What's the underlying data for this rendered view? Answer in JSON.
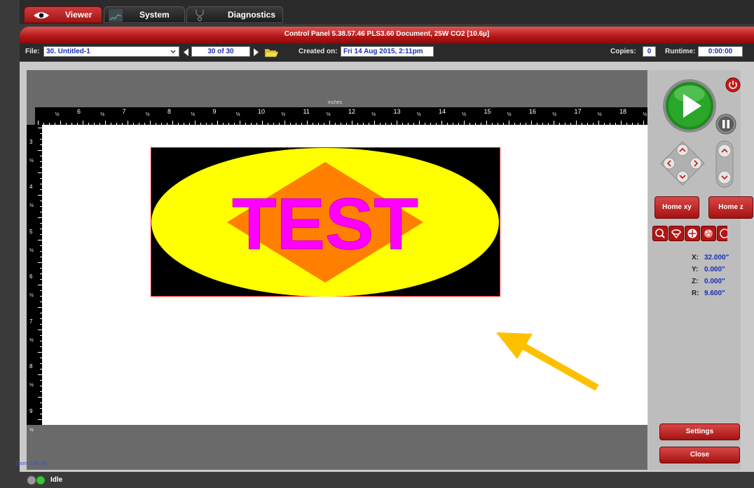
{
  "tabs": [
    {
      "label": "Viewer"
    },
    {
      "label": "System"
    },
    {
      "label": "Diagnostics"
    }
  ],
  "title": "Control Panel   5.38.57.46    PLS3.60 Document, 25W CO2 [10.6µ]",
  "filebar": {
    "file_label": "File:",
    "file_value": "30. Untitled-1",
    "page_value": "30 of 30",
    "created_label": "Created on:",
    "created_value": "Fri 14 Aug 2015,  2:11pm",
    "copies_label": "Copies:",
    "copies_value": "0",
    "runtime_label": "Runtime:",
    "runtime_value": "0:00:00"
  },
  "ruler": {
    "unit_label": "inches",
    "h_numbers": [
      "6",
      "7",
      "8",
      "9",
      "10",
      "11",
      "12",
      "13",
      "14",
      "15",
      "16",
      "17",
      "18"
    ],
    "half_label": "½",
    "v_numbers": [
      "3",
      "4",
      "5",
      "6",
      "7",
      "8",
      "9"
    ]
  },
  "artwork": {
    "text": "TEST",
    "colors": {
      "background": "#000000",
      "ellipse": "#ffff00",
      "diamond": "#ff8000",
      "text": "#ff00ff",
      "outline": "#ff0000"
    }
  },
  "arrow_color": "#ffc000",
  "zoom": "Zoom: 178.3%",
  "controls": {
    "home_xy": "Home xy",
    "home_z": "Home z",
    "settings": "Settings",
    "close": "Close"
  },
  "coordinates": [
    {
      "axis": "X:",
      "value": "32.000\""
    },
    {
      "axis": "Y:",
      "value": "0.000\""
    },
    {
      "axis": "Z:",
      "value": "0.000\""
    },
    {
      "axis": "R:",
      "value": "9.600\""
    }
  ],
  "status": "Idle"
}
